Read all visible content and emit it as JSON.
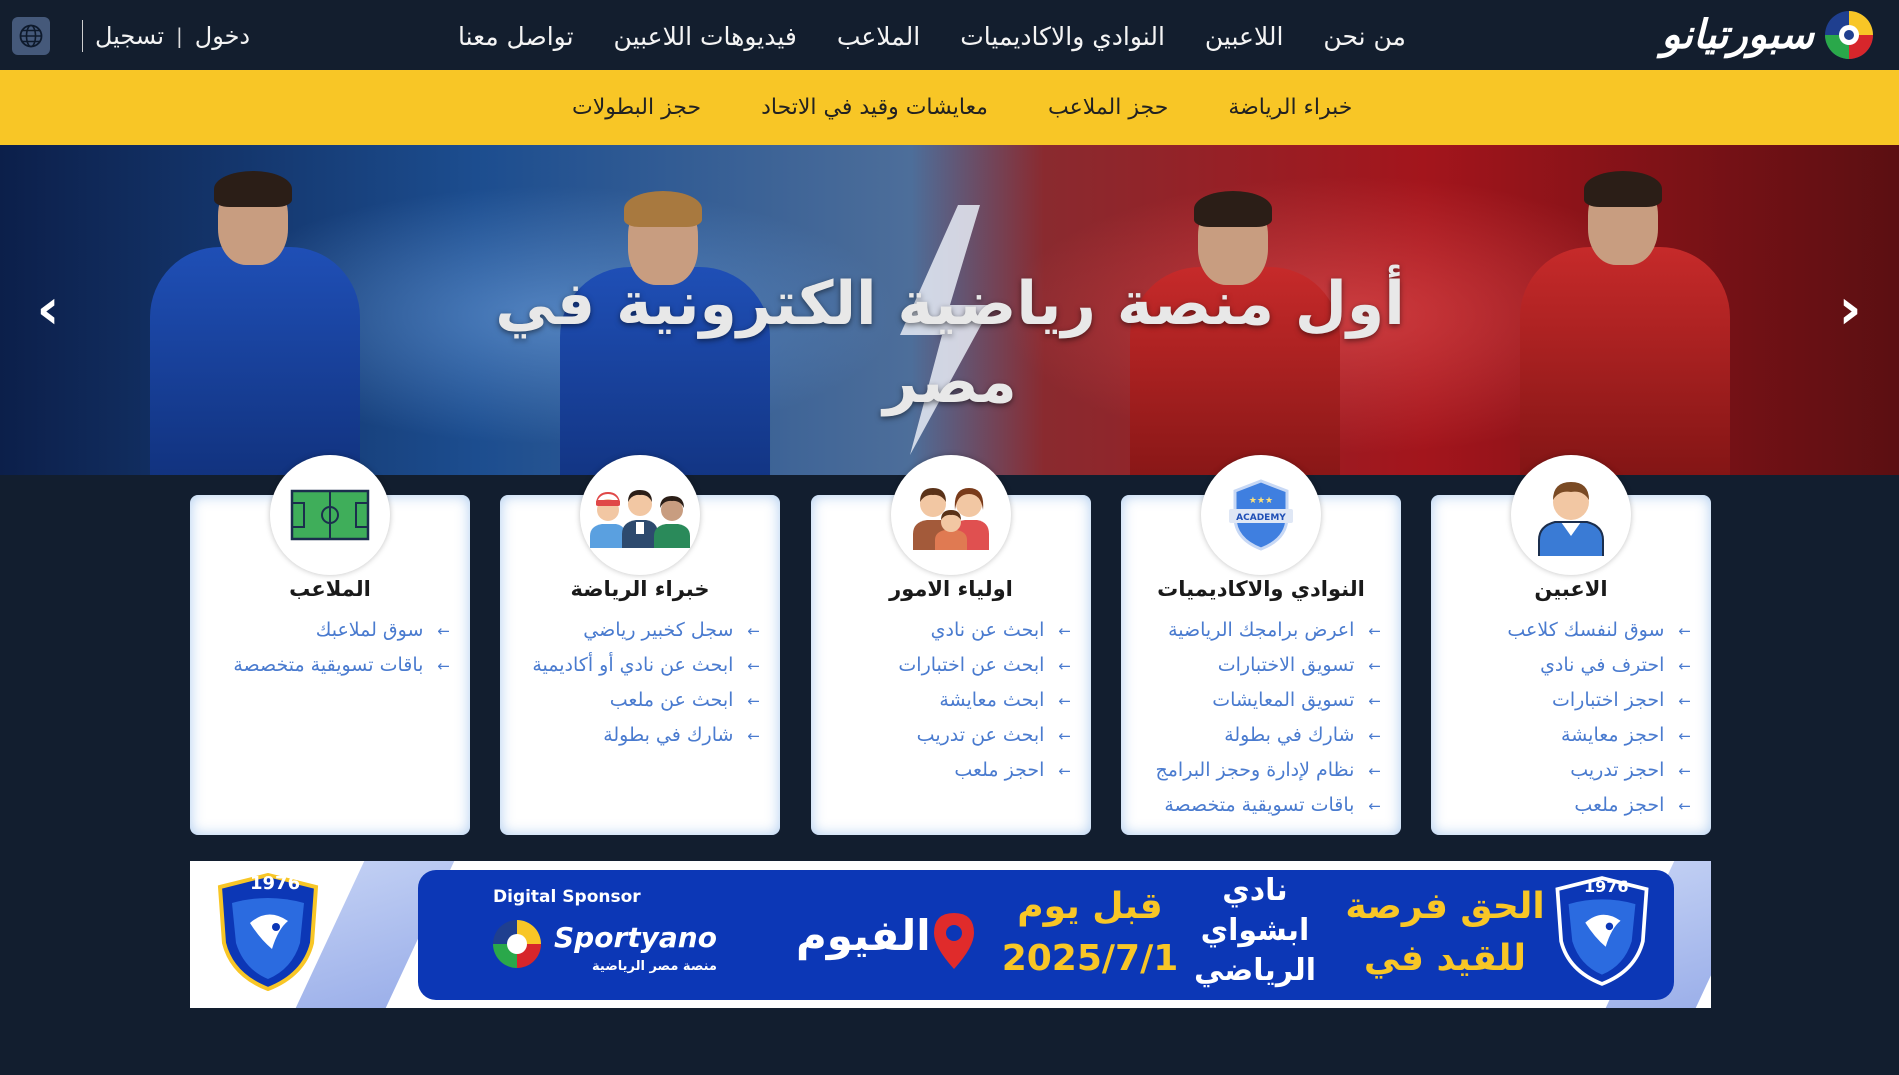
{
  "header": {
    "login": "دخول",
    "separator": "|",
    "register": "تسجيل",
    "nav": [
      "من نحن",
      "اللاعبين",
      "النوادي والاكاديميات",
      "الملاعب",
      "فيديوهات اللاعبين",
      "تواصل معنا"
    ],
    "logo_text": "سبورتيانو"
  },
  "subnav": [
    "خبراء الرياضة",
    "حجز الملاعب",
    "معايشات وقيد في الاتحاد",
    "حجز البطولات"
  ],
  "hero": {
    "title": "أول منصة رياضية الكترونية في مصر"
  },
  "cards": [
    {
      "title": "الاعبين",
      "icon": "player-icon",
      "links": [
        "سوق لنفسك كلاعب",
        "احترف في نادي",
        "احجز اختبارات",
        "احجز معايشة",
        "احجز تدريب",
        "احجز ملعب"
      ]
    },
    {
      "title": "النوادي والاكاديميات",
      "icon": "academy-icon",
      "links": [
        "اعرض برامجك الرياضية",
        "تسويق الاختبارات",
        "تسويق المعايشات",
        "شارك في بطولة",
        "نظام لإدارة وحجز البرامج",
        "باقات تسويقية متخصصة"
      ]
    },
    {
      "title": "اولياء الامور",
      "icon": "family-icon",
      "links": [
        "ابحث عن نادي",
        "ابحث عن اختبارات",
        "ابحث معايشة",
        "ابحث عن تدريب",
        "احجز ملعب"
      ]
    },
    {
      "title": "خبراء الرياضة",
      "icon": "experts-icon",
      "links": [
        "سجل كخبير رياضي",
        "ابحث عن نادي أو أكاديمية",
        "ابحث عن ملعب",
        "شارك في بطولة"
      ]
    },
    {
      "title": "الملاعب",
      "icon": "field-icon",
      "links": [
        "سوق لملاعبك",
        "باقات تسويقية متخصصة"
      ]
    }
  ],
  "banner": {
    "headline_line1": "الحق فرصة",
    "headline_line2": "للقيد في",
    "club_line1": "نادي",
    "club_line2": "ابشواي",
    "club_line3": "الرياضي",
    "deadline_line1": "قبل يوم",
    "deadline_line2": "2025/7/1",
    "location": "الفيوم",
    "sponsor_label": "Digital Sponsor",
    "sponsor_name": "Sportyano",
    "sponsor_tagline": "منصة مصر الرياضية",
    "club_year": "1976"
  },
  "colors": {
    "navbar_bg": "#131e2e",
    "subnav_bg": "#f8c626",
    "link_blue": "#4a7bcf",
    "banner_blue": "#0c37b6",
    "banner_yellow": "#f8c626"
  }
}
